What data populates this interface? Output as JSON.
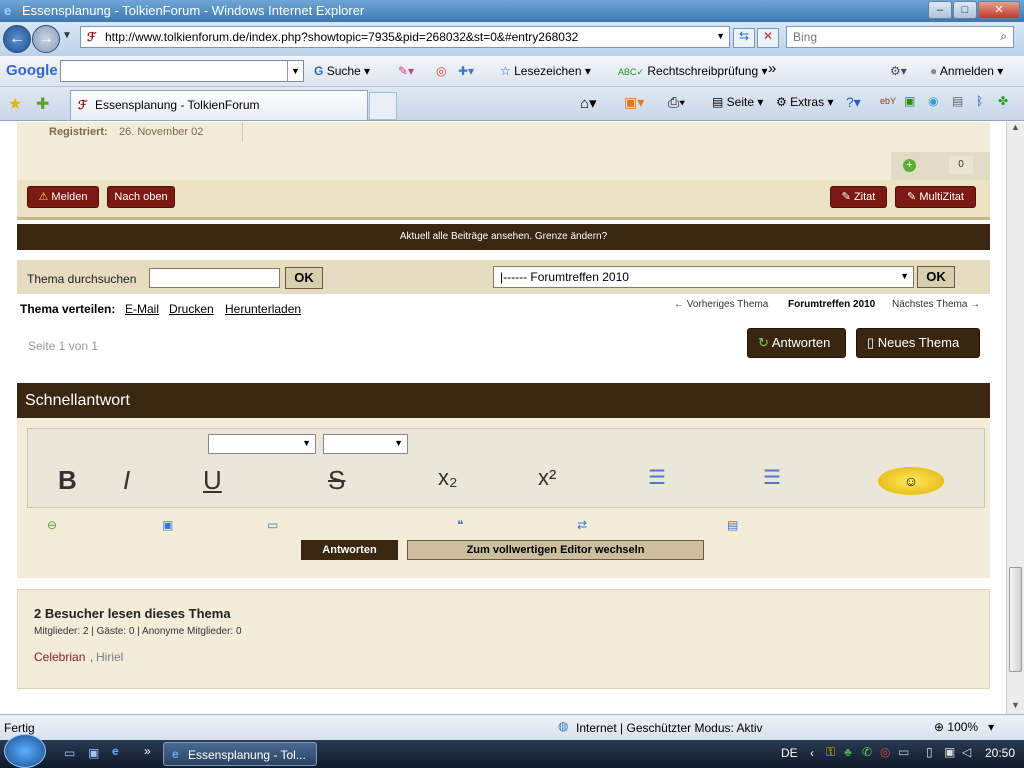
{
  "window": {
    "title": "Essensplanung - TolkienForum - Windows Internet Explorer",
    "url": "http://www.tolkienforum.de/index.php?showtopic=7935&pid=268032&st=0&#entry268032",
    "search_placeholder": "Bing"
  },
  "google_toolbar": {
    "brand": "Google",
    "search": "Suche",
    "bookmarks": "Lesezeichen",
    "spellcheck": "Rechtschreibprüfung",
    "more": "»",
    "signin": "Anmelden"
  },
  "tabbar": {
    "tab_title": "Essensplanung - TolkienForum",
    "home": "Seite",
    "extras": "Extras"
  },
  "post": {
    "registered_label": "Registriert:",
    "registered_value": "26. November 02",
    "rep": "0",
    "report": "Melden",
    "top": "Nach oben",
    "quote": "Zitat",
    "multiquote": "MultiZitat"
  },
  "notice": "Aktuell alle Beiträge ansehen. Grenze ändern?",
  "search_topic": {
    "label": "Thema durchsuchen",
    "ok": "OK",
    "forum_select": "|------ Forumtreffen 2010",
    "ok2": "OK"
  },
  "share": {
    "label": "Thema verteilen:",
    "email": "E-Mail",
    "print": "Drucken",
    "download": "Herunterladen"
  },
  "topic_nav": {
    "prev": "← Vorheriges Thema",
    "current": "Forumtreffen 2010",
    "next": "Nächstes Thema →"
  },
  "pagination": "Seite 1 von 1",
  "buttons": {
    "reply": "Antworten",
    "new_topic": "Neues Thema"
  },
  "quick_reply": {
    "title": "Schnellantwort",
    "submit": "Antworten",
    "full_editor": "Zum vollwertigen Editor wechseln"
  },
  "viewers": {
    "title": "2 Besucher lesen dieses Thema",
    "stats": "Mitglieder: 2 | Gäste: 0 | Anonyme Mitglieder: 0",
    "user1": "Celebrian",
    "user2": "Hiriel",
    "sep": ","
  },
  "status": {
    "left": "Fertig",
    "zone": "Internet | Geschützter Modus: Aktiv",
    "zoom": "100%"
  },
  "taskbar": {
    "task": "Essensplanung - Tol...",
    "lang": "DE",
    "time": "20:50"
  },
  "colors": {
    "page_bg": "#f3ecd8",
    "dark_brown": "#3b2612",
    "red_button": "#7a1a12",
    "link_red": "#8a1c30",
    "link_gray": "#777a88"
  }
}
